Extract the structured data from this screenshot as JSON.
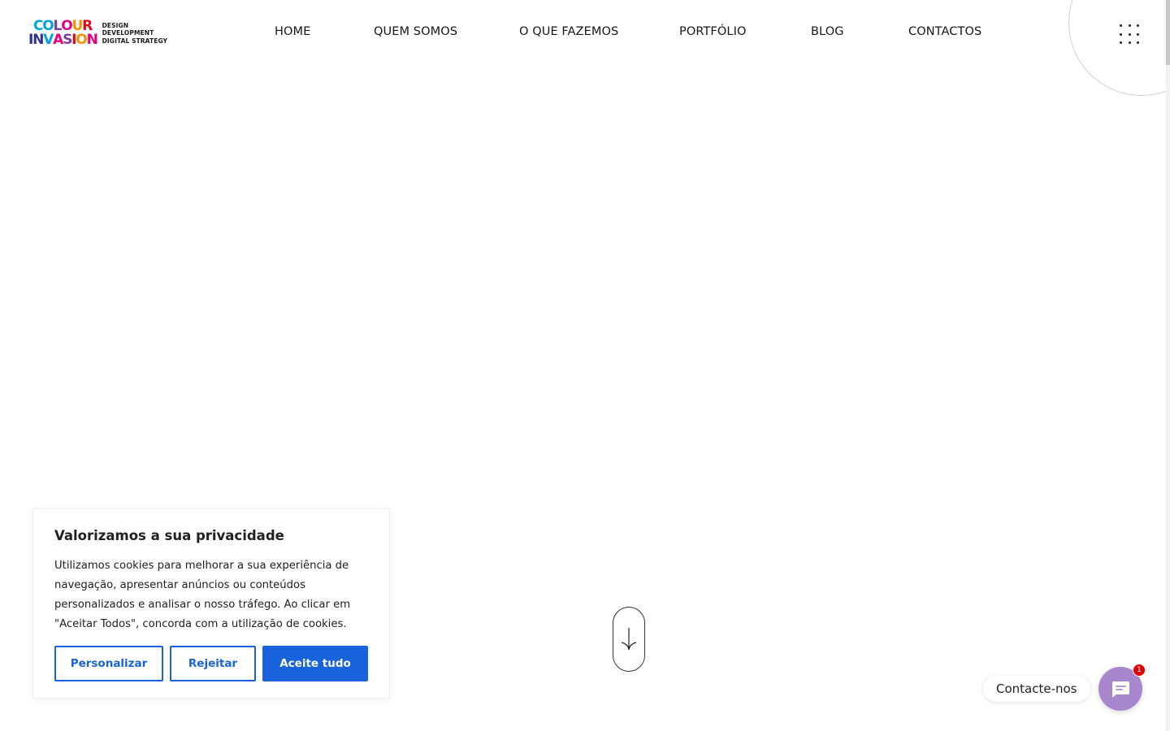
{
  "brand": {
    "logo_line1": [
      "C",
      "O",
      "L",
      "O",
      "U",
      "R"
    ],
    "logo_line2": [
      "I",
      "N",
      "V",
      "A",
      "S",
      "I",
      "O",
      "N"
    ],
    "logo_line1_colors": [
      "#00a3e0",
      "#00a3e0",
      "#7a3fa0",
      "#e6007e",
      "#f39200",
      "#e30613"
    ],
    "logo_line2_colors": [
      "#2e3192",
      "#2e3192",
      "#00a3e0",
      "#e6007e",
      "#7a3fa0",
      "#e30613",
      "#f39200",
      "#e6007e"
    ],
    "tagline": [
      "DESIGN",
      "DEVELOPMENT",
      "DIGITAL STRATEGY"
    ]
  },
  "nav": {
    "items": [
      {
        "label": "HOME"
      },
      {
        "label": "QUEM SOMOS"
      },
      {
        "label": "O QUE FAZEMOS"
      },
      {
        "label": "PORTFÓLIO"
      },
      {
        "label": "BLOG"
      },
      {
        "label": "CONTACTOS"
      }
    ],
    "menu_icon": "grid-dots-icon"
  },
  "hero": {
    "scroll_icon": "arrow-down-icon"
  },
  "cookie": {
    "title": "Valorizamos a sua privacidade",
    "text": "Utilizamos cookies para melhorar a sua experiência de navegação, apresentar anúncios ou conteúdos personalizados e analisar o nosso tráfego. Ao clicar em \"Aceitar Todos\", concorda com a utilização de cookies.",
    "customize_label": "Personalizar",
    "reject_label": "Rejeitar",
    "accept_label": "Aceite tudo",
    "accent_color": "#1863dc"
  },
  "contact_widget": {
    "label": "Contacte-nos",
    "badge_count": "1",
    "icon": "chat-icon",
    "color": "#a886cd"
  }
}
